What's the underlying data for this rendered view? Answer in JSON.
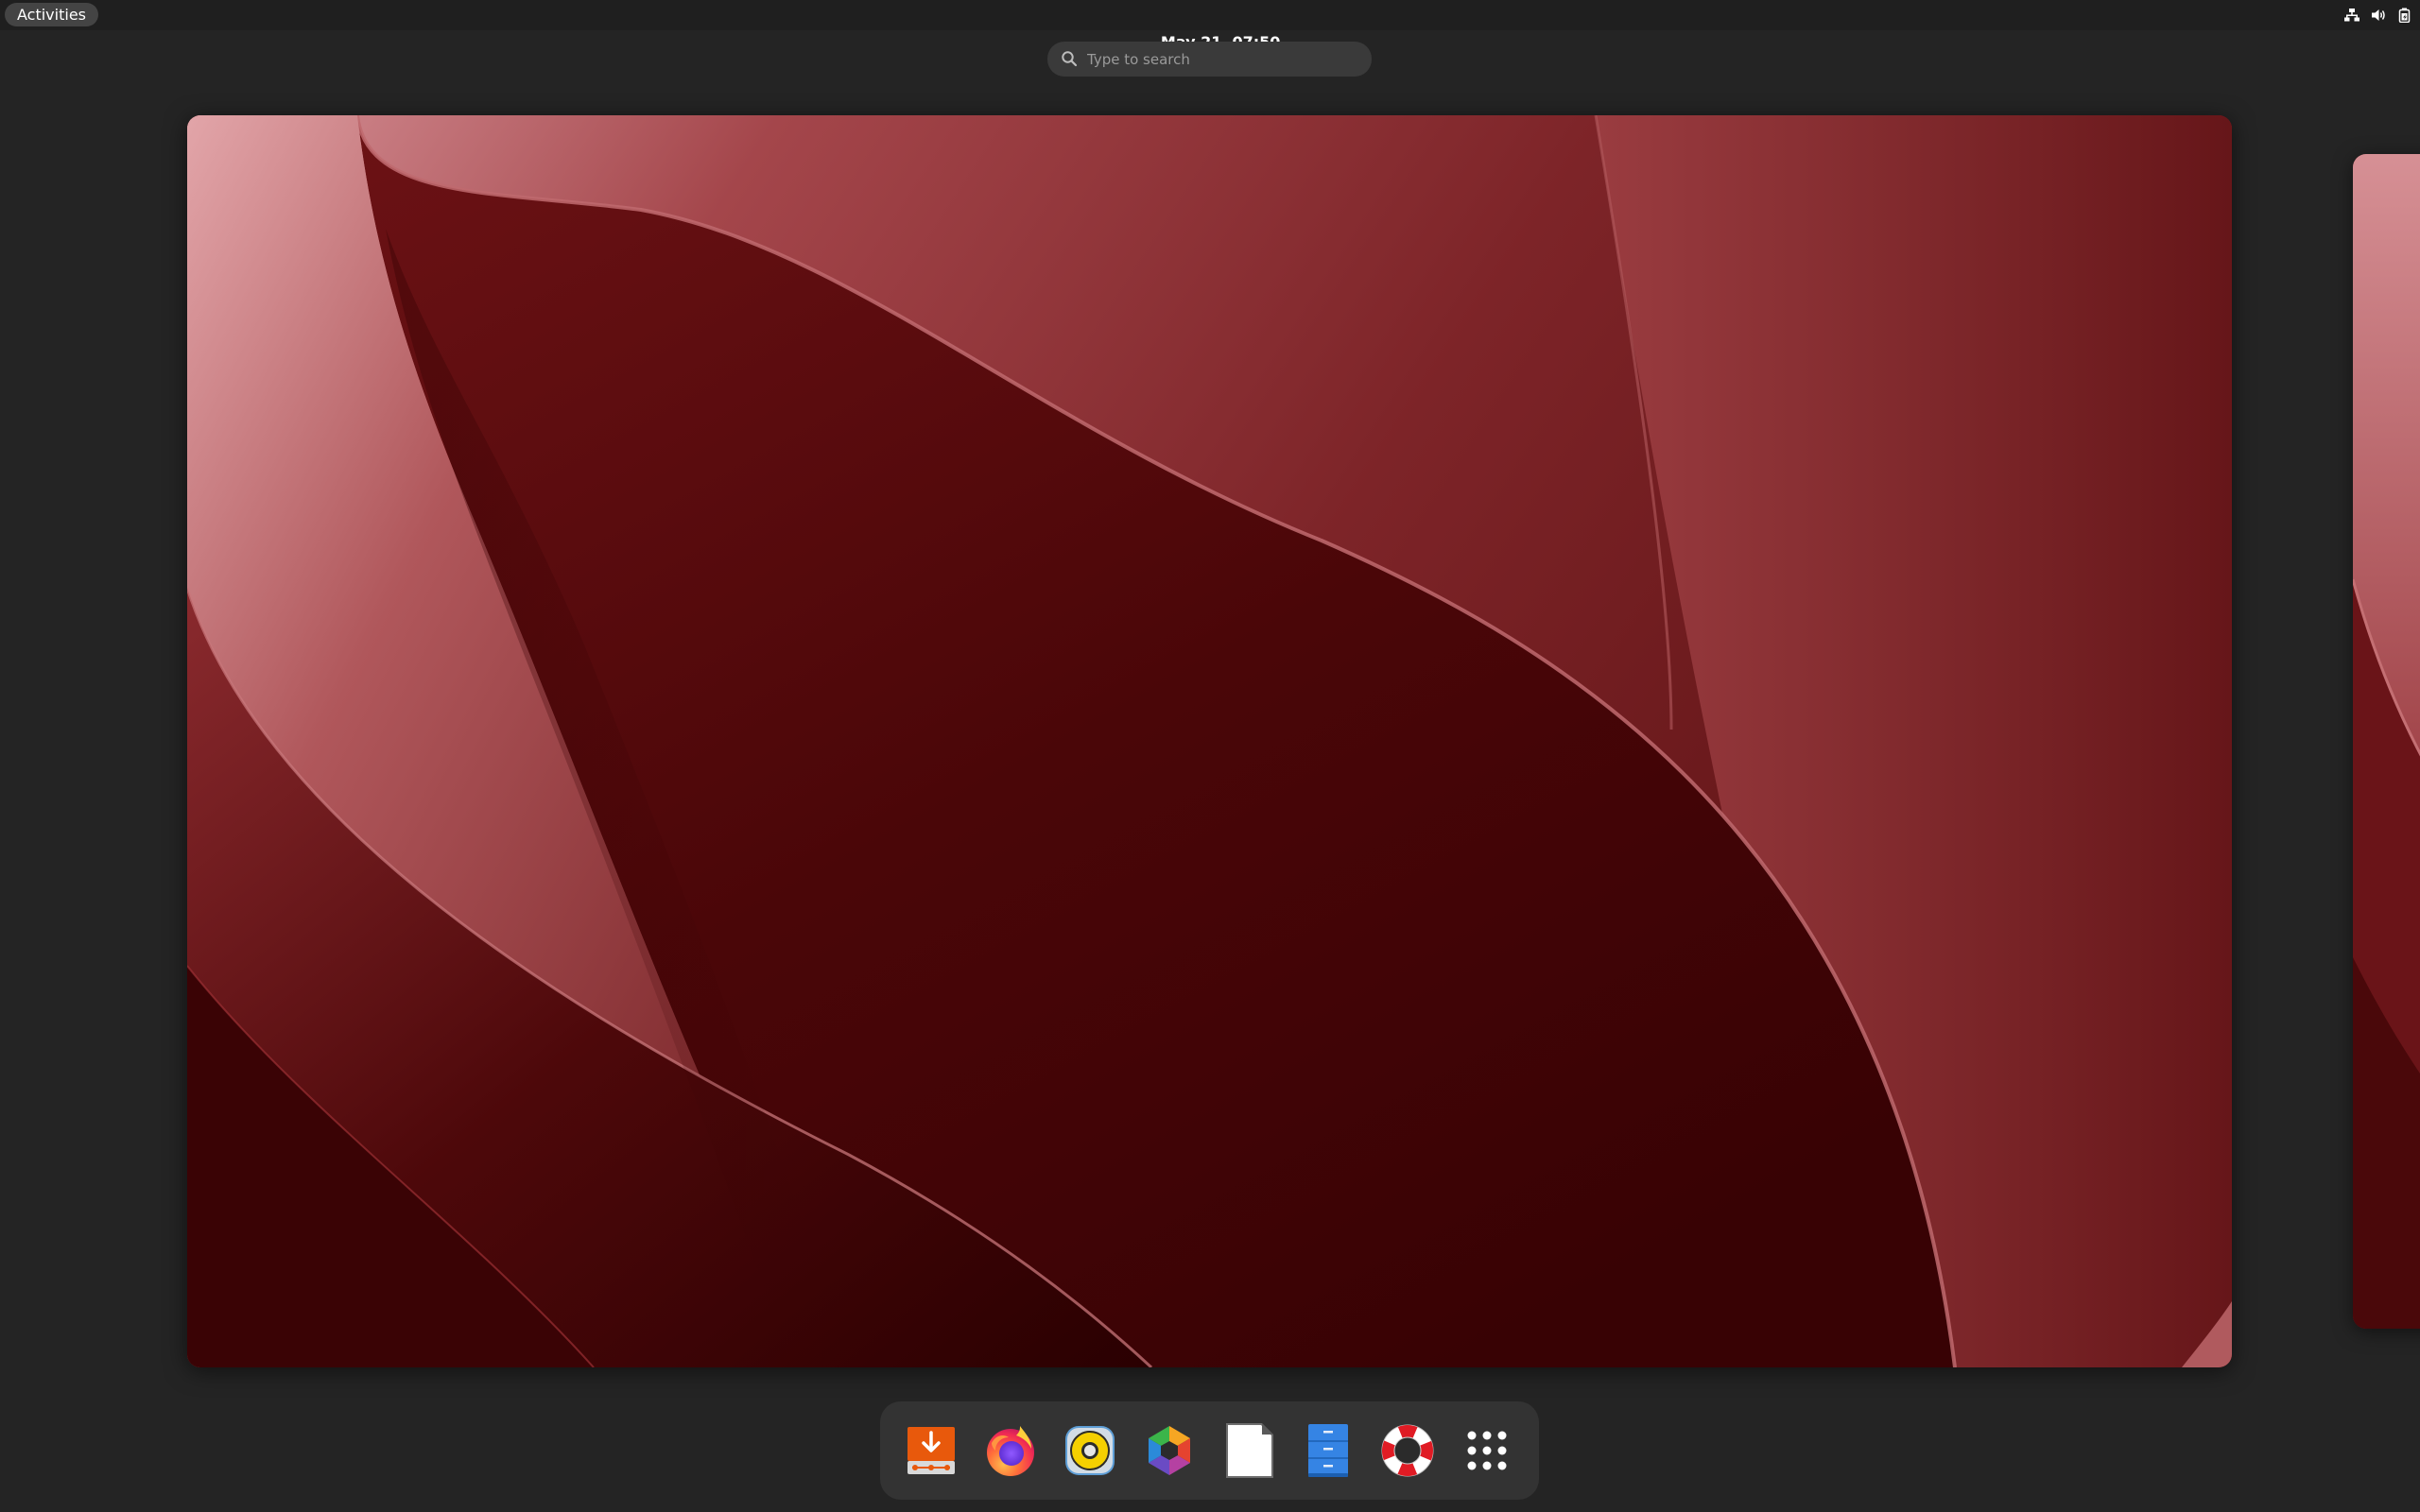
{
  "topbar": {
    "activities_label": "Activities",
    "clock": "May 21  07:50",
    "tray_icons": [
      "network-wired-icon",
      "volume-icon",
      "battery-icon"
    ]
  },
  "search": {
    "placeholder": "Type to search",
    "value": ""
  },
  "workspace": {
    "wallpaper_colors": [
      "#e1a0a3",
      "#9b3a3f",
      "#6e1a1c",
      "#3d0305"
    ]
  },
  "dock": {
    "items": [
      {
        "name": "Software Install",
        "icon": "package-installer-icon"
      },
      {
        "name": "Firefox",
        "icon": "firefox-icon"
      },
      {
        "name": "Rhythmbox",
        "icon": "speaker-icon"
      },
      {
        "name": "Photos",
        "icon": "hexagon-color-icon"
      },
      {
        "name": "Document",
        "icon": "document-icon"
      },
      {
        "name": "File Cabinet",
        "icon": "file-cabinet-icon"
      },
      {
        "name": "Help",
        "icon": "lifebuoy-icon"
      },
      {
        "name": "Show Apps",
        "icon": "app-grid-icon"
      }
    ]
  }
}
